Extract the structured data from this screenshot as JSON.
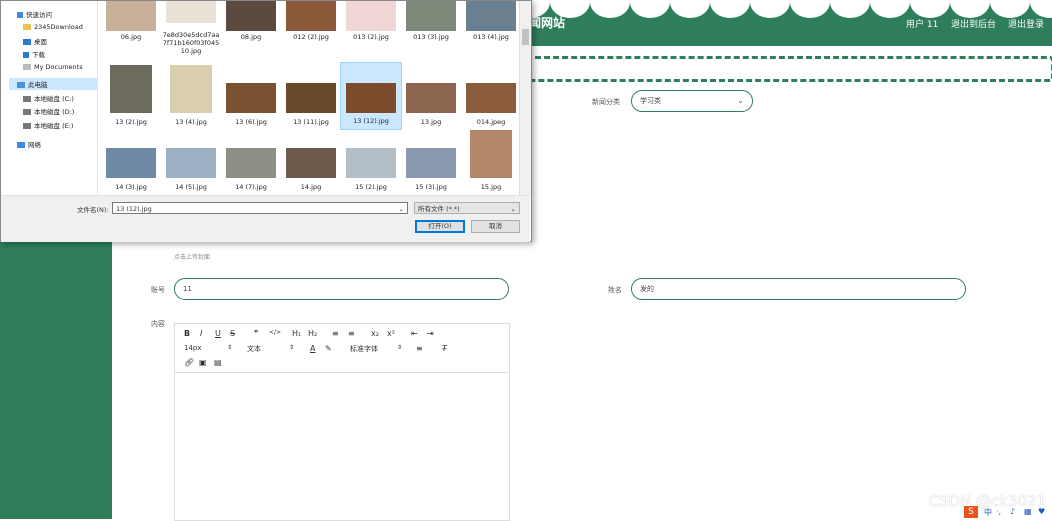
{
  "site": {
    "title": "新闻网站",
    "user_link": "用户 11",
    "backend_link": "退出到后台",
    "logout_link": "退出登录"
  },
  "form": {
    "category_label": "新闻分类",
    "category_value": "学习类",
    "upload_hint": "点击上传封面",
    "account_label": "账号",
    "account_value": "11",
    "name_label": "姓名",
    "name_value": "发的",
    "content_label": "内容",
    "editor": {
      "row1": [
        "B",
        "I",
        "U",
        "S",
        "❞",
        "</>",
        "H₁",
        "H₂",
        "≡",
        "≡",
        "x₂",
        "x²",
        "⇤",
        "⇥"
      ],
      "font_size": "14px",
      "paragraph": "文本",
      "font_family": "标准字体"
    }
  },
  "dialog": {
    "nav": {
      "quick_access": "快速访问",
      "items": [
        "2345Download",
        "桌面",
        "下载",
        "My Documents"
      ],
      "this_pc": "此电脑",
      "drives": [
        "本地磁盘 (C:)",
        "本地磁盘 (D:)",
        "本地磁盘 (E:)"
      ],
      "network": "网络"
    },
    "files_row1": [
      "06.jpg",
      "7e8d30e5dcd7aa7f71b160f03f04510.jpg",
      "08.jpg",
      "012 (2).jpg",
      "013 (2).jpg",
      "013 (3).jpg",
      "013 (4).jpg"
    ],
    "files_row2": [
      "13 (2).jpg",
      "13 (4).jpg",
      "13 (6).jpg",
      "13 (11).jpg",
      "13 (12).jpg",
      "13.jpg",
      "014.jpeg"
    ],
    "files_row3": [
      "14 (3).jpg",
      "14 (5).jpg",
      "14 (7).jpg",
      "14.jpg",
      "15 (2).jpg",
      "15 (3).jpg",
      "15.jpg"
    ],
    "filename_label": "文件名(N):",
    "filename_value": "13 (12).jpg",
    "filter_value": "所有文件 (*.*)",
    "open_button": "打开(O)",
    "cancel_button": "取消"
  },
  "watermark": "CSDN @ck3021",
  "colors": {
    "theme": "#2e7d5b",
    "selection": "#cce8ff"
  }
}
